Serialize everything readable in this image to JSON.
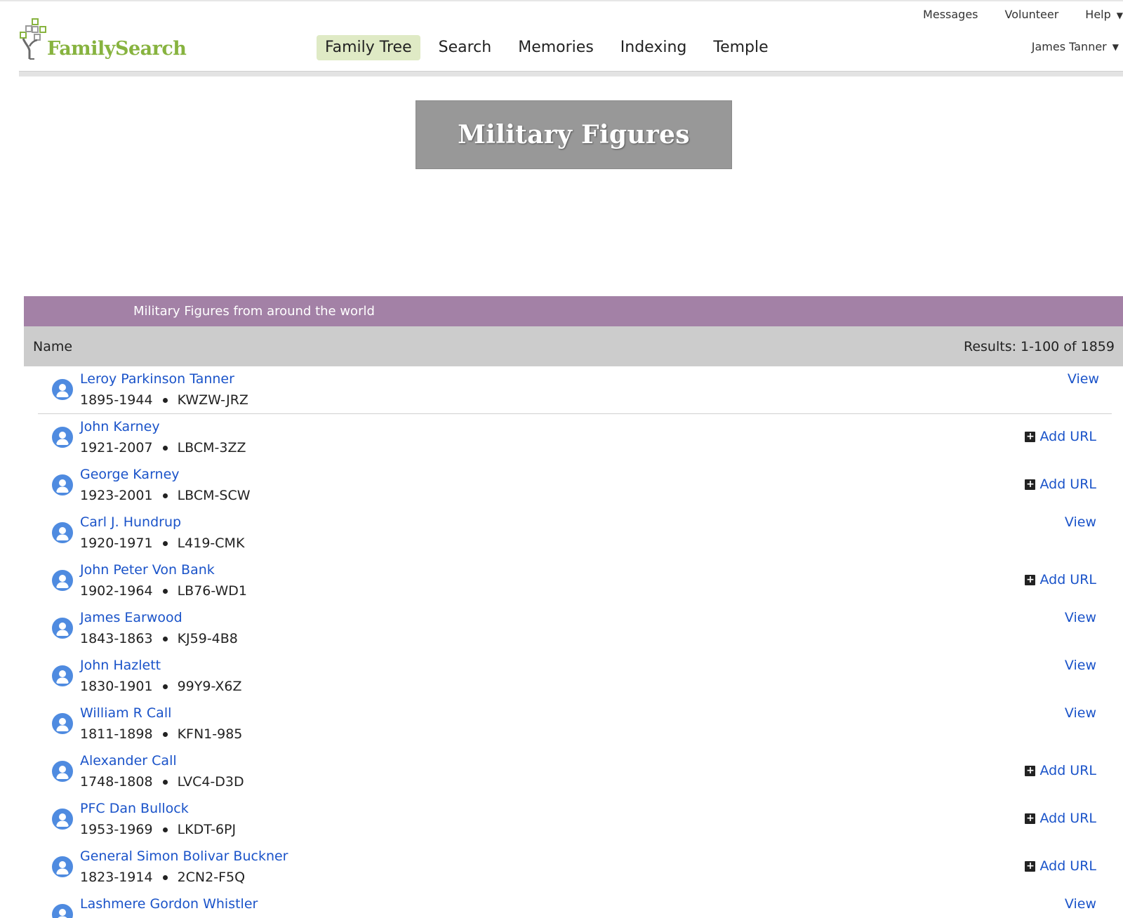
{
  "colors": {
    "brand_green": "#87b33f",
    "active_tab_bg": "#dfeac5",
    "banner_bg": "#989898",
    "list_header_bg": "#a381a6",
    "column_header_bg": "#cccccc",
    "link_blue": "#1a53c9",
    "avatar_blue": "#4f8be0"
  },
  "header": {
    "logo_text": "FamilySearch",
    "utility_nav": [
      {
        "label": "Messages"
      },
      {
        "label": "Volunteer"
      },
      {
        "label": "Help",
        "icon": "caret-down-icon"
      }
    ],
    "main_nav": [
      {
        "label": "Family Tree",
        "active": true
      },
      {
        "label": "Search"
      },
      {
        "label": "Memories"
      },
      {
        "label": "Indexing"
      },
      {
        "label": "Temple"
      }
    ],
    "user_name": "James Tanner"
  },
  "banner": {
    "title": "Military Figures"
  },
  "list": {
    "header": "Military Figures from around the world",
    "column_name": "Name",
    "results": "Results: 1-100 of 1859",
    "rows": [
      {
        "name": "Leroy Parkinson Tanner",
        "dates": "1895-1944",
        "pid": "KWZW-JRZ",
        "action": "View"
      },
      {
        "name": "John Karney",
        "dates": "1921-2007",
        "pid": "LBCM-3ZZ",
        "action": "Add URL"
      },
      {
        "name": "George Karney",
        "dates": "1923-2001",
        "pid": "LBCM-SCW",
        "action": "Add URL"
      },
      {
        "name": "Carl J. Hundrup",
        "dates": "1920-1971",
        "pid": "L419-CMK",
        "action": "View"
      },
      {
        "name": "John Peter Von Bank",
        "dates": "1902-1964",
        "pid": "LB76-WD1",
        "action": "Add URL"
      },
      {
        "name": "James Earwood",
        "dates": "1843-1863",
        "pid": "KJ59-4B8",
        "action": "View"
      },
      {
        "name": "John Hazlett",
        "dates": "1830-1901",
        "pid": "99Y9-X6Z",
        "action": "View"
      },
      {
        "name": "William R Call",
        "dates": "1811-1898",
        "pid": "KFN1-985",
        "action": "View"
      },
      {
        "name": "Alexander Call",
        "dates": "1748-1808",
        "pid": "LVC4-D3D",
        "action": "Add URL"
      },
      {
        "name": "PFC Dan Bullock",
        "dates": "1953-1969",
        "pid": "LKDT-6PJ",
        "action": "Add URL"
      },
      {
        "name": "General Simon Bolivar Buckner",
        "dates": "1823-1914",
        "pid": "2CN2-F5Q",
        "action": "Add URL"
      },
      {
        "name": "Lashmere Gordon Whistler",
        "dates": "",
        "pid": "",
        "action": "View"
      }
    ]
  }
}
